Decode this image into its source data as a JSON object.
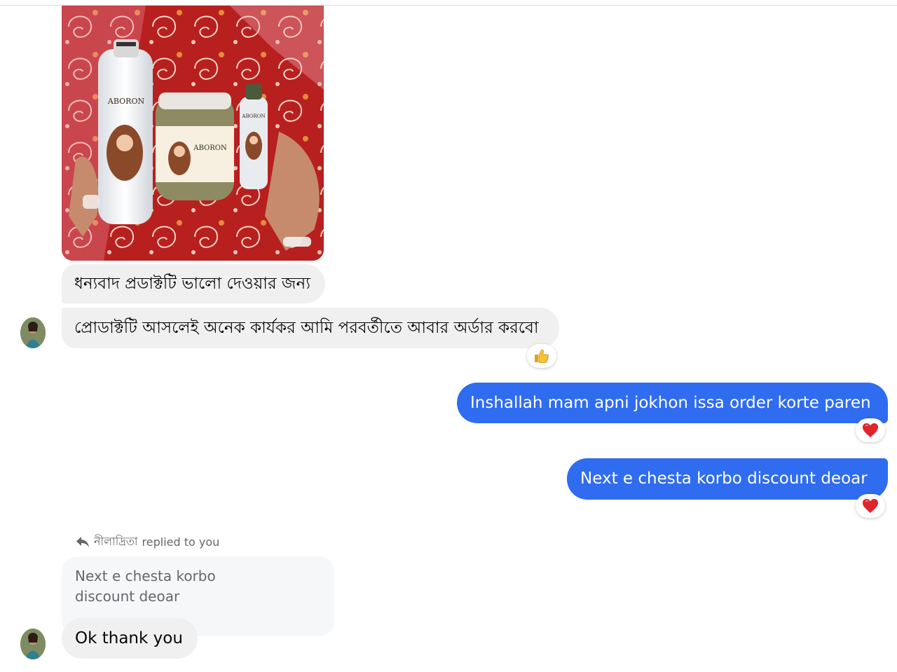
{
  "thread": {
    "shared_photo": {
      "product_brand_text": "ABORON",
      "description": "three hair care product containers held in hands"
    },
    "messages": [
      {
        "sender": "contact",
        "text": "ধন্যবাদ প্রডাক্টটি ভালো দেওয়ার জন্য"
      },
      {
        "sender": "contact",
        "text": "প্রোডাক্টটি আসলেই অনেক কার্যকর আমি পরবর্তীতে আবার অর্ডার করবো",
        "reaction": "thumbs-up"
      },
      {
        "sender": "me",
        "text": "Inshallah mam apni jokhon issa order korte paren",
        "reaction": "heart"
      },
      {
        "sender": "me",
        "text": "Next e chesta korbo discount deoar",
        "reaction": "heart"
      }
    ],
    "reply": {
      "header_name": "নীলাদ্রিতা",
      "header_suffix": "replied to you",
      "quoted_line_1": "Next e chesta korbo",
      "quoted_line_2": "discount deoar",
      "text": "Ok thank you"
    },
    "colors": {
      "outgoing_bubble": "#2f6cf0",
      "incoming_bubble": "#f0f0f0",
      "quoted_bubble": "#f6f7f9"
    }
  }
}
